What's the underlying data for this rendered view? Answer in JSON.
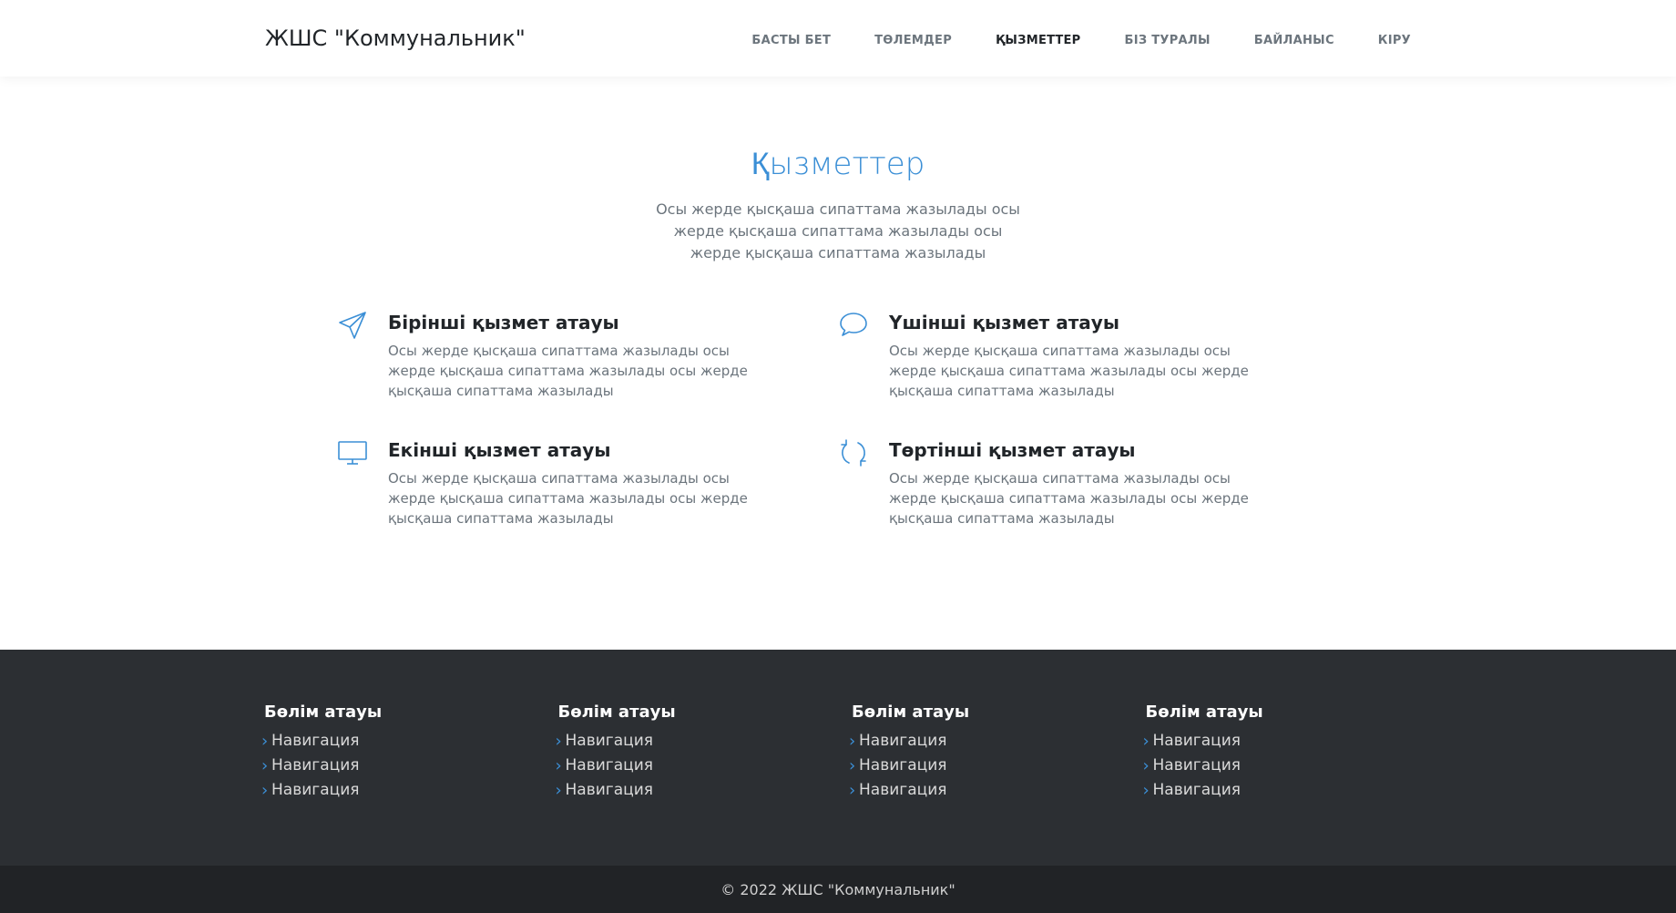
{
  "header": {
    "brand": "ЖШС \"Коммунальник\"",
    "nav": [
      {
        "label": "БАСТЫ БЕТ",
        "active": false
      },
      {
        "label": "ТӨЛЕМДЕР",
        "active": false
      },
      {
        "label": "ҚЫЗМЕТТЕР",
        "active": true
      },
      {
        "label": "БІЗ ТУРАЛЫ",
        "active": false
      },
      {
        "label": "БАЙЛАНЫС",
        "active": false
      },
      {
        "label": "КІРУ",
        "active": false
      }
    ]
  },
  "services": {
    "title": "Қызметтер",
    "description": "Осы жерде қысқаша сипаттама жазылады осы жерде қысқаша сипаттама жазылады осы жерде қысқаша сипаттама жазылады",
    "items": [
      {
        "icon": "paper-plane-icon",
        "title": "Бірінші қызмет атауы",
        "text": "Осы жерде қысқаша сипаттама жазылады осы жерде қысқаша сипаттама жазылады осы жерде қысқаша сипаттама жазылады"
      },
      {
        "icon": "chat-bubble-icon",
        "title": "Үшінші қызмет атауы",
        "text": "Осы жерде қысқаша сипаттама жазылады осы жерде қысқаша сипаттама жазылады осы жерде қысқаша сипаттама жазылады"
      },
      {
        "icon": "monitor-icon",
        "title": "Екінші қызмет атауы",
        "text": "Осы жерде қысқаша сипаттама жазылады осы жерде қысқаша сипаттама жазылады осы жерде қысқаша сипаттама жазылады"
      },
      {
        "icon": "refresh-icon",
        "title": "Төртінші қызмет атауы",
        "text": "Осы жерде қысқаша сипаттама жазылады осы жерде қысқаша сипаттама жазылады осы жерде қысқаша сипаттама жазылады"
      }
    ]
  },
  "footer": {
    "columns": [
      {
        "title": "Бөлім атауы",
        "links": [
          "Навигация",
          "Навигация",
          "Навигация"
        ]
      },
      {
        "title": "Бөлім атауы",
        "links": [
          "Навигация",
          "Навигация",
          "Навигация"
        ]
      },
      {
        "title": "Бөлім атауы",
        "links": [
          "Навигация",
          "Навигация",
          "Навигация"
        ]
      },
      {
        "title": "Бөлім атауы",
        "links": [
          "Навигация",
          "Навигация",
          "Навигация"
        ]
      }
    ],
    "copyright": "© 2022 ЖШС \"Коммунальник\""
  },
  "colors": {
    "accent": "#3b8fd6",
    "footer_bg": "#2c2f33",
    "copyright_bg": "#212326"
  }
}
